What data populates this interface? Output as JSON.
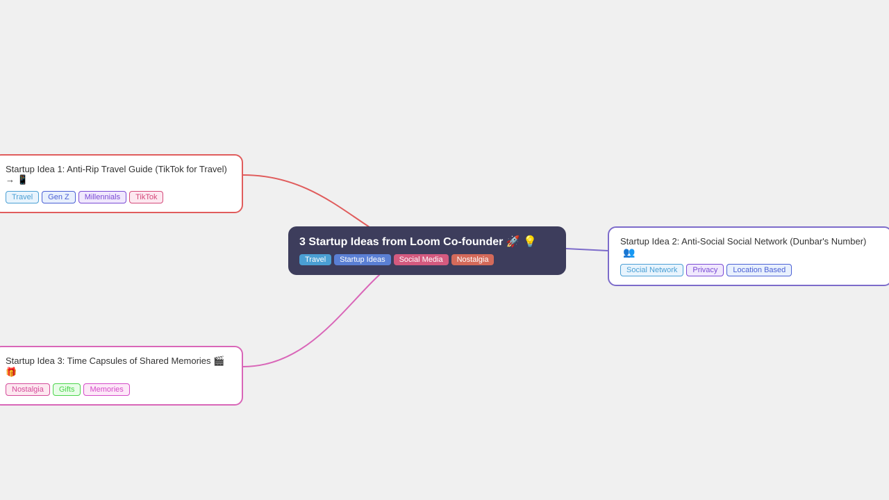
{
  "center": {
    "title": "3 Startup Ideas from Loom Co-founder 🚀 💡",
    "tags": [
      "Travel",
      "Startup Ideas",
      "Social Media",
      "Nostalgia"
    ]
  },
  "idea1": {
    "title": "Startup Idea 1: Anti-Rip Travel Guide (TikTok for Travel) →",
    "icon": "📱",
    "tags": [
      "Travel",
      "Gen Z",
      "Millennials",
      "TikTok"
    ]
  },
  "idea2": {
    "title": "Startup Idea 2: Anti-Social Social Network (Dunbar's Number)",
    "icon": "👥",
    "tags": [
      "Social Network",
      "Privacy",
      "Location Based"
    ]
  },
  "idea3": {
    "title": "Startup Idea 3: Time Capsules of Shared Memories 🎬 🎁",
    "tags": [
      "Nostalgia",
      "Gifts",
      "Memories"
    ]
  },
  "connections": {
    "idea1_color": "#e05c5c",
    "idea2_color": "#7c6bca",
    "idea3_color": "#d966b8"
  }
}
